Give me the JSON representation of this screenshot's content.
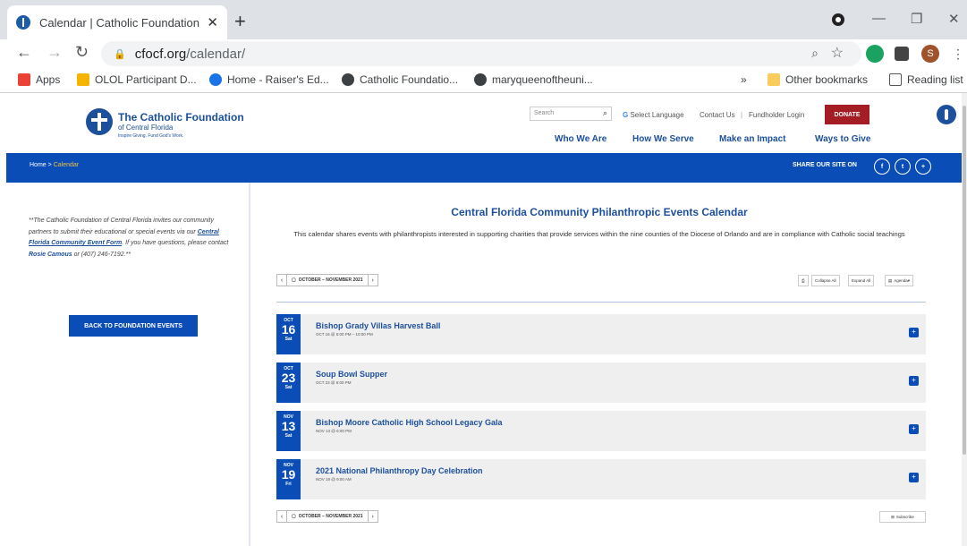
{
  "browser": {
    "tab_title": "Calendar | Catholic Foundation of",
    "url_domain": "cfocf.org",
    "url_path": "/calendar/",
    "profile_initial": "S",
    "bookmarks": [
      {
        "label": "Apps",
        "color": "#ea4335"
      },
      {
        "label": "OLOL Participant D...",
        "color": "#f4b400"
      },
      {
        "label": "Home - Raiser's Ed...",
        "color": "#1a73e8"
      },
      {
        "label": "Catholic Foundatio...",
        "color": "#3c4043"
      },
      {
        "label": "maryqueenoftheuni...",
        "color": "#3c4043"
      }
    ],
    "more_bookmarks": "»",
    "other_bookmarks": "Other bookmarks",
    "reading_list": "Reading list"
  },
  "header": {
    "logo_name": "The Catholic Foundation",
    "logo_sub": "of Central Florida",
    "logo_tagline": "Inspire Giving. Fund God's Work.",
    "search_placeholder": "Search",
    "select_language": "Select Language",
    "contact": "Contact Us",
    "fundholder": "Fundholder Login",
    "donate": "DONATE",
    "nav": [
      "Who We Are",
      "How We Serve",
      "Make an Impact",
      "Ways to Give"
    ],
    "brand_color": "#0b4db7",
    "donate_color": "#a51d24"
  },
  "breadcrumb": {
    "home": "Home",
    "sep": ">",
    "current": "Calendar"
  },
  "share": {
    "label": "SHARE OUR SITE ON",
    "icons": [
      "f",
      "t",
      "+"
    ]
  },
  "sidebar": {
    "text_1": "**The Catholic Foundation of Central Florida invites our community partners to submit their educational or special events via our ",
    "link": "Central Florida Community Event Form",
    "text_2": ". If you have questions, please contact ",
    "contact_name": "Rosie Camous",
    "text_3": " or (407) 246-7192.**",
    "back_button": "BACK TO FOUNDATION EVENTS"
  },
  "main": {
    "title": "Central Florida Community Philanthropic Events Calendar",
    "description": "This calendar shares events with philanthropists interested in supporting charities that provide services within the nine counties of the Diocese of Orlando and are in compliance with Catholic social teachings",
    "range_label": "OCTOBER – NOVEMBER 2021",
    "prev": "‹",
    "next": "›",
    "print": "⎙",
    "collapse_all": "Collapse All",
    "expand_all": "Expand All",
    "view": "Agenda",
    "subscribe": "Subscribe",
    "events": [
      {
        "month": "OCT",
        "day": "16",
        "weekday": "Sat",
        "title": "Bishop Grady Villas Harvest Ball",
        "when": "OCT 16 @ 6:00 PM – 10:00 PM"
      },
      {
        "month": "OCT",
        "day": "23",
        "weekday": "Sat",
        "title": "Soup Bowl Supper",
        "when": "OCT 23 @ 6:00 PM"
      },
      {
        "month": "NOV",
        "day": "13",
        "weekday": "Sat",
        "title": "Bishop Moore Catholic High School Legacy Gala",
        "when": "NOV 13 @ 6:00 PM"
      },
      {
        "month": "NOV",
        "day": "19",
        "weekday": "Fri",
        "title": "2021 National Philanthropy Day Celebration",
        "when": "NOV 19 @ 9:00 AM"
      }
    ]
  }
}
